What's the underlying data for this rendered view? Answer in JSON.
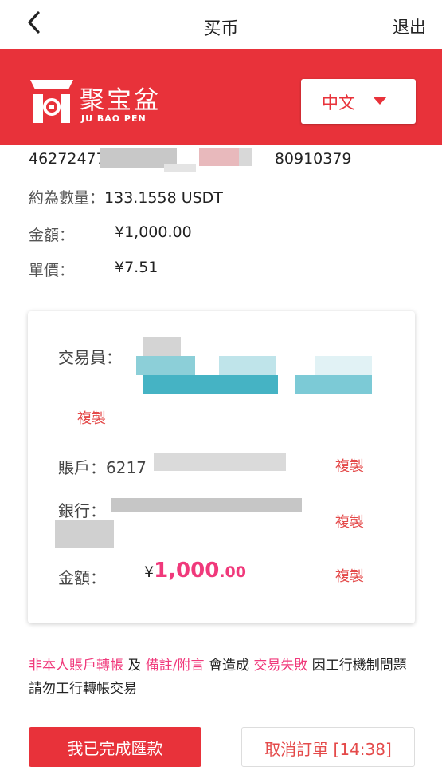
{
  "header": {
    "title": "买币",
    "logout_label": "退出"
  },
  "brand": {
    "name_cn": "聚宝盆",
    "name_en": "JU BAO PEN"
  },
  "language": {
    "selected": "中文"
  },
  "order": {
    "id_prefix": "46272477",
    "id_suffix": "80910379",
    "quantity_label": "約為數量：",
    "quantity_value": "133.1558 USDT",
    "amount_label": "金額：",
    "amount_value": "¥1,000.00",
    "price_label": "單價：",
    "price_value": "¥7.51"
  },
  "payee_card": {
    "trader_label": "交易員：",
    "copy_label": "複製",
    "account_label": "賬戶：",
    "account_prefix": "6217",
    "bank_label": "銀行：",
    "amount_label": "金額：",
    "amount_currency": "¥",
    "amount_integer": "1,000",
    "amount_decimal": ".00"
  },
  "notice": {
    "part1": "非本人賬戶轉帳",
    "part2": " 及 ",
    "part3": "備註/附言",
    "part4": " 會造成 ",
    "part5": "交易失敗",
    "part6": " 因工行機制問題請勿工行轉帳交易"
  },
  "actions": {
    "done_label": "我已完成匯款",
    "cancel_label": "取消訂單 [14:38]"
  },
  "colors": {
    "brand_red": "#e8323a",
    "accent_pink": "#f0397b"
  }
}
